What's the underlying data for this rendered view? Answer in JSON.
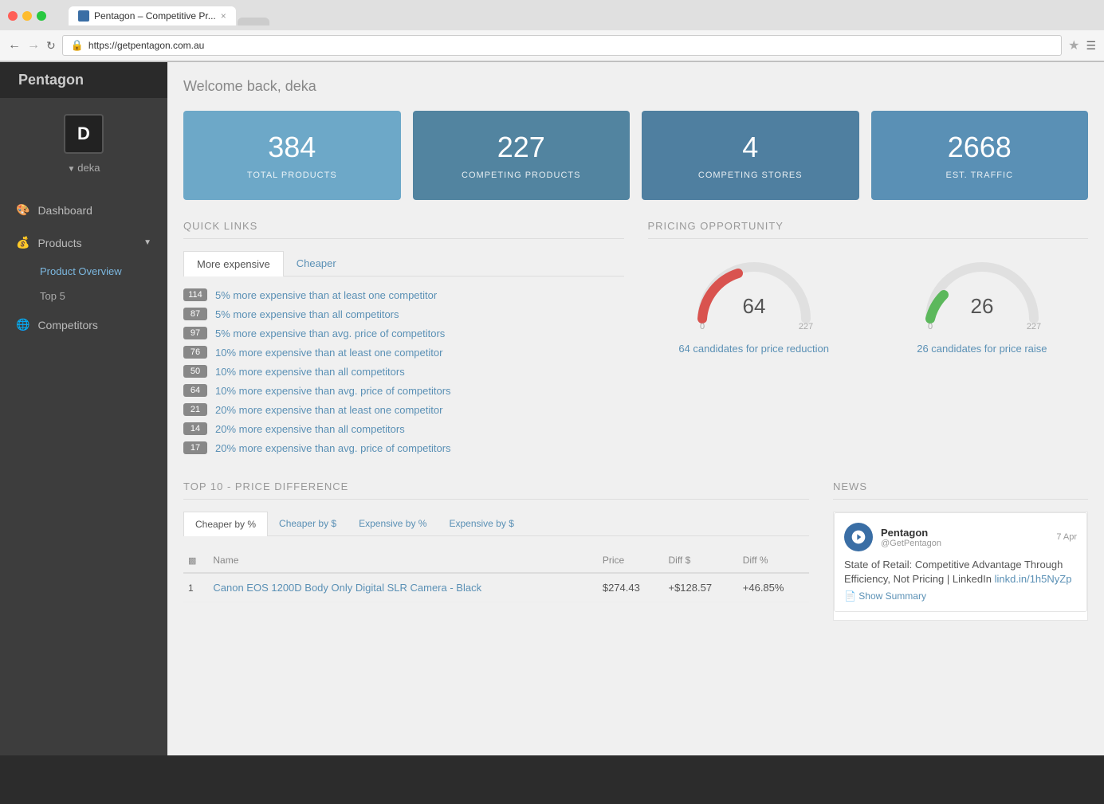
{
  "browser": {
    "url": "https://getpentagon.com.au",
    "tab_title": "Pentagon – Competitive Pr...",
    "tab_close": "×"
  },
  "sidebar": {
    "brand": "Pentagon",
    "logo_letter": "D",
    "user": "deka",
    "nav": [
      {
        "id": "dashboard",
        "label": "Dashboard",
        "icon": "🎨"
      },
      {
        "id": "products",
        "label": "Products",
        "icon": "💰",
        "has_arrow": true
      },
      {
        "id": "competitors",
        "label": "Competitors",
        "icon": "🌐"
      }
    ],
    "sub_nav": [
      {
        "id": "product-overview",
        "label": "Product Overview",
        "active": true
      },
      {
        "id": "top5",
        "label": "Top 5"
      }
    ]
  },
  "main": {
    "welcome": "Welcome back, deka",
    "stats": [
      {
        "number": "384",
        "label": "TOTAL PRODUCTS",
        "color": "blue-light"
      },
      {
        "number": "227",
        "label": "COMPETING PRODUCTS",
        "color": "blue-mid"
      },
      {
        "number": "4",
        "label": "COMPETING STORES",
        "color": "blue-dark"
      },
      {
        "number": "2668",
        "label": "EST. TRAFFIC",
        "color": "blue-mid"
      }
    ],
    "quick_links": {
      "title": "QUICK LINKS",
      "tabs": [
        {
          "id": "more-expensive",
          "label": "More expensive",
          "active": true
        },
        {
          "id": "cheaper",
          "label": "Cheaper",
          "active_link": true
        }
      ],
      "items": [
        {
          "badge": "114",
          "text": "5% more expensive than at least one competitor"
        },
        {
          "badge": "87",
          "text": "5% more expensive than all competitors"
        },
        {
          "badge": "97",
          "text": "5% more expensive than avg. price of competitors"
        },
        {
          "badge": "76",
          "text": "10% more expensive than at least one competitor"
        },
        {
          "badge": "50",
          "text": "10% more expensive than all competitors"
        },
        {
          "badge": "64",
          "text": "10% more expensive than avg. price of competitors"
        },
        {
          "badge": "21",
          "text": "20% more expensive than at least one competitor"
        },
        {
          "badge": "14",
          "text": "20% more expensive than all competitors"
        },
        {
          "badge": "17",
          "text": "20% more expensive than avg. price of competitors"
        }
      ]
    },
    "pricing_opportunity": {
      "title": "PRICING OPPORTUNITY",
      "gauge_left": {
        "value": 64,
        "max": 227,
        "min": 0,
        "label": "64 candidates for price reduction",
        "color_arc": "#d9534f"
      },
      "gauge_right": {
        "value": 26,
        "max": 227,
        "min": 0,
        "label": "26 candidates for price raise",
        "color_arc": "#5cb85c"
      }
    },
    "price_diff": {
      "title": "TOP 10 - PRICE DIFFERENCE",
      "tabs": [
        {
          "id": "cheaper-pct",
          "label": "Cheaper by %",
          "active": true
        },
        {
          "id": "cheaper-dollar",
          "label": "Cheaper by $"
        },
        {
          "id": "expensive-pct",
          "label": "Expensive by %"
        },
        {
          "id": "expensive-dollar",
          "label": "Expensive by $"
        }
      ],
      "columns": [
        {
          "id": "rank",
          "label": "#",
          "icon": "📊"
        },
        {
          "id": "name",
          "label": "Name"
        },
        {
          "id": "price",
          "label": "Price"
        },
        {
          "id": "diff_dollar",
          "label": "Diff $"
        },
        {
          "id": "diff_pct",
          "label": "Diff %"
        }
      ],
      "rows": [
        {
          "rank": "1",
          "name": "Canon EOS 1200D Body Only Digital SLR Camera - Black",
          "price": "$274.43",
          "diff_dollar": "+$128.57",
          "diff_pct": "+46.85%"
        }
      ]
    },
    "news": {
      "title": "NEWS",
      "items": [
        {
          "source_name": "Pentagon",
          "source_handle": "@GetPentagon",
          "date": "7 Apr",
          "body": "State of Retail: Competitive Advantage Through Efficiency, Not Pricing | LinkedIn ",
          "link_text": "linkd.in/1h5NyZp",
          "link_url": "#",
          "show_summary": "Show Summary"
        }
      ]
    }
  }
}
